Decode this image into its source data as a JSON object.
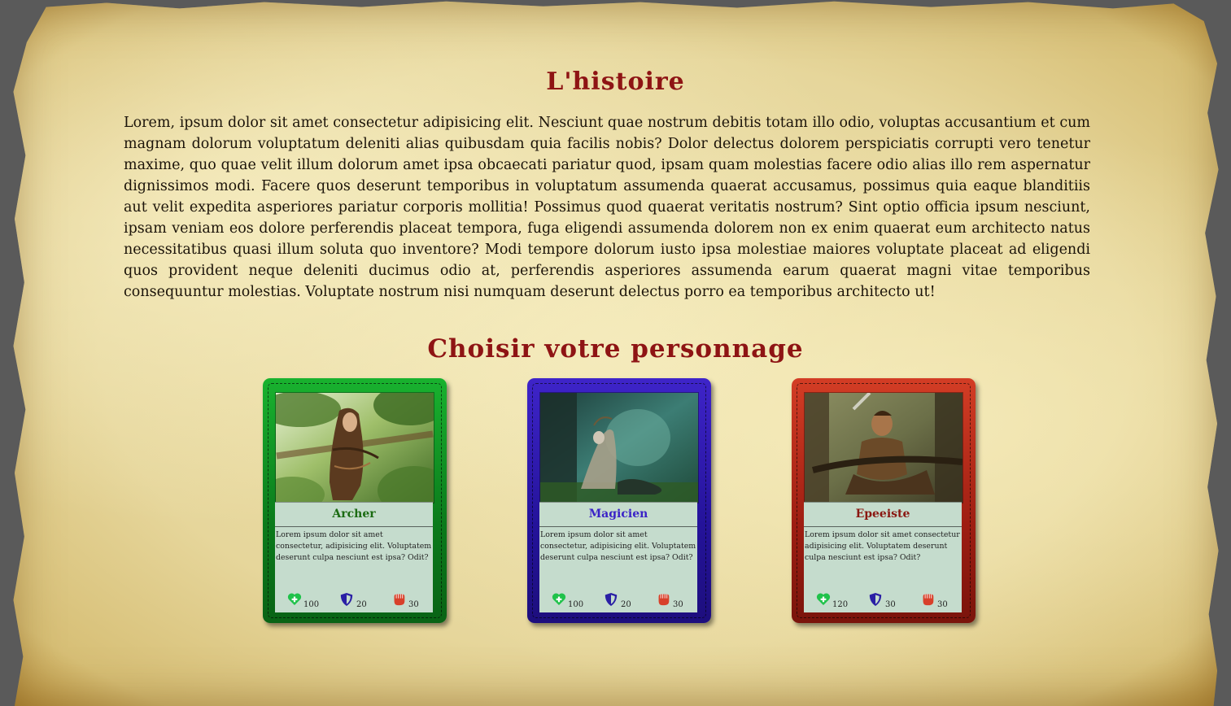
{
  "story": {
    "title": "L'histoire",
    "text": "Lorem, ipsum dolor sit amet consectetur adipisicing elit. Nesciunt quae nostrum debitis totam illo odio, voluptas accusantium et cum magnam dolorum voluptatum deleniti alias quibusdam quia facilis nobis? Dolor delectus dolorem perspiciatis corrupti vero tenetur maxime, quo quae velit illum dolorum amet ipsa obcaecati pariatur quod, ipsam quam molestias facere odio alias illo rem aspernatur dignissimos modi. Facere quos deserunt temporibus in voluptatum assumenda quaerat accusamus, possimus quia eaque blanditiis aut velit expedita asperiores pariatur corporis mollitia! Possimus quod quaerat veritatis nostrum? Sint optio officia ipsum nesciunt, ipsam veniam eos dolore perferendis placeat tempora, fuga eligendi assumenda dolorem non ex enim quaerat eum architecto natus necessitatibus quasi illum soluta quo inventore? Modi tempore dolorum iusto ipsa molestiae maiores voluptate placeat ad eligendi quos provident neque deleniti ducimus odio at, perferendis asperiores assumenda earum quaerat magni vitae temporibus consequuntur molestias. Voluptate nostrum nisi numquam deserunt delectus porro ea temporibus architecto ut!"
  },
  "choose": {
    "title": "Choisir votre personnage"
  },
  "cards": [
    {
      "name": "Archer",
      "description": "Lorem ipsum dolor sit amet consectetur, adipisicing elit. Voluptatem deserunt culpa nesciunt est ipsa? Odit?",
      "health": "100",
      "defense": "20",
      "attack": "30",
      "color": "#12a127"
    },
    {
      "name": "Magicien",
      "description": "Lorem ipsum dolor sit amet consectetur, adipisicing elit. Voluptatem deserunt culpa nesciunt est ipsa? Odit?",
      "health": "100",
      "defense": "20",
      "attack": "30",
      "color": "#2e1cb5"
    },
    {
      "name": "Epeeiste",
      "description": "Lorem ipsum dolor sit amet consectetur adipisicing elit. Voluptatem deserunt culpa nesciunt est ipsa? Odit?",
      "health": "120",
      "defense": "30",
      "attack": "30",
      "color": "#c0321d"
    }
  ],
  "icons": {
    "health": "heart-plus-icon",
    "defense": "shield-icon",
    "attack": "fist-icon"
  },
  "colors": {
    "title": "#8e1414",
    "health_icon": "#1fc24a",
    "defense_icon": "#2a1fa5",
    "attack_icon": "#d8402a"
  }
}
